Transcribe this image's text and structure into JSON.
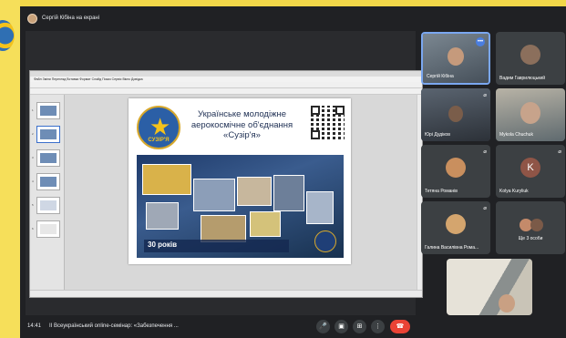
{
  "presenter": {
    "label": "Сергій Кібіна на екрані"
  },
  "shared_screen": {
    "lo_title_bar": "",
    "lo_menu": "Файл  Зміни  Перегляд  Вставка  Формат  Слайд  Показ  Сервіс  Вікно  Довідка",
    "slide": {
      "logo_text": "СУЗІР'Я",
      "title_line1": "Українське молодіжне",
      "title_line2": "аерокосмічне об'єднання",
      "title_line3": "«Сузір'я»",
      "collage_caption": "30 років"
    }
  },
  "participants": [
    {
      "name": "Сергій Кібіна",
      "role": "self",
      "speaking": true
    },
    {
      "name": "Вадим Гаврилюцький",
      "role": "video"
    },
    {
      "name": "Юрі Дудіков",
      "role": "video"
    },
    {
      "name": "Mykola Chuchuk",
      "role": "video"
    },
    {
      "name": "Тетяна Романів",
      "role": "avatar"
    },
    {
      "name": "Kolya Kuryliuk",
      "role": "letter",
      "letter": "K"
    },
    {
      "name": "Галина Василівна Рома...",
      "role": "avatar"
    },
    {
      "name": "Ще 3 особи",
      "role": "more"
    },
    {
      "name": "",
      "role": "video-self-preview"
    }
  ],
  "bottom_bar": {
    "time": "14:41",
    "title": "ІІ Всеукраїнський online-семінар: «Забезпечення ...",
    "controls": [
      "mic",
      "camera",
      "present",
      "more",
      "end-call"
    ]
  },
  "colors": {
    "meet_bg": "#202124",
    "tile_bg": "#3c4043",
    "end_call": "#ea4335",
    "frame": "#f3e27a"
  }
}
